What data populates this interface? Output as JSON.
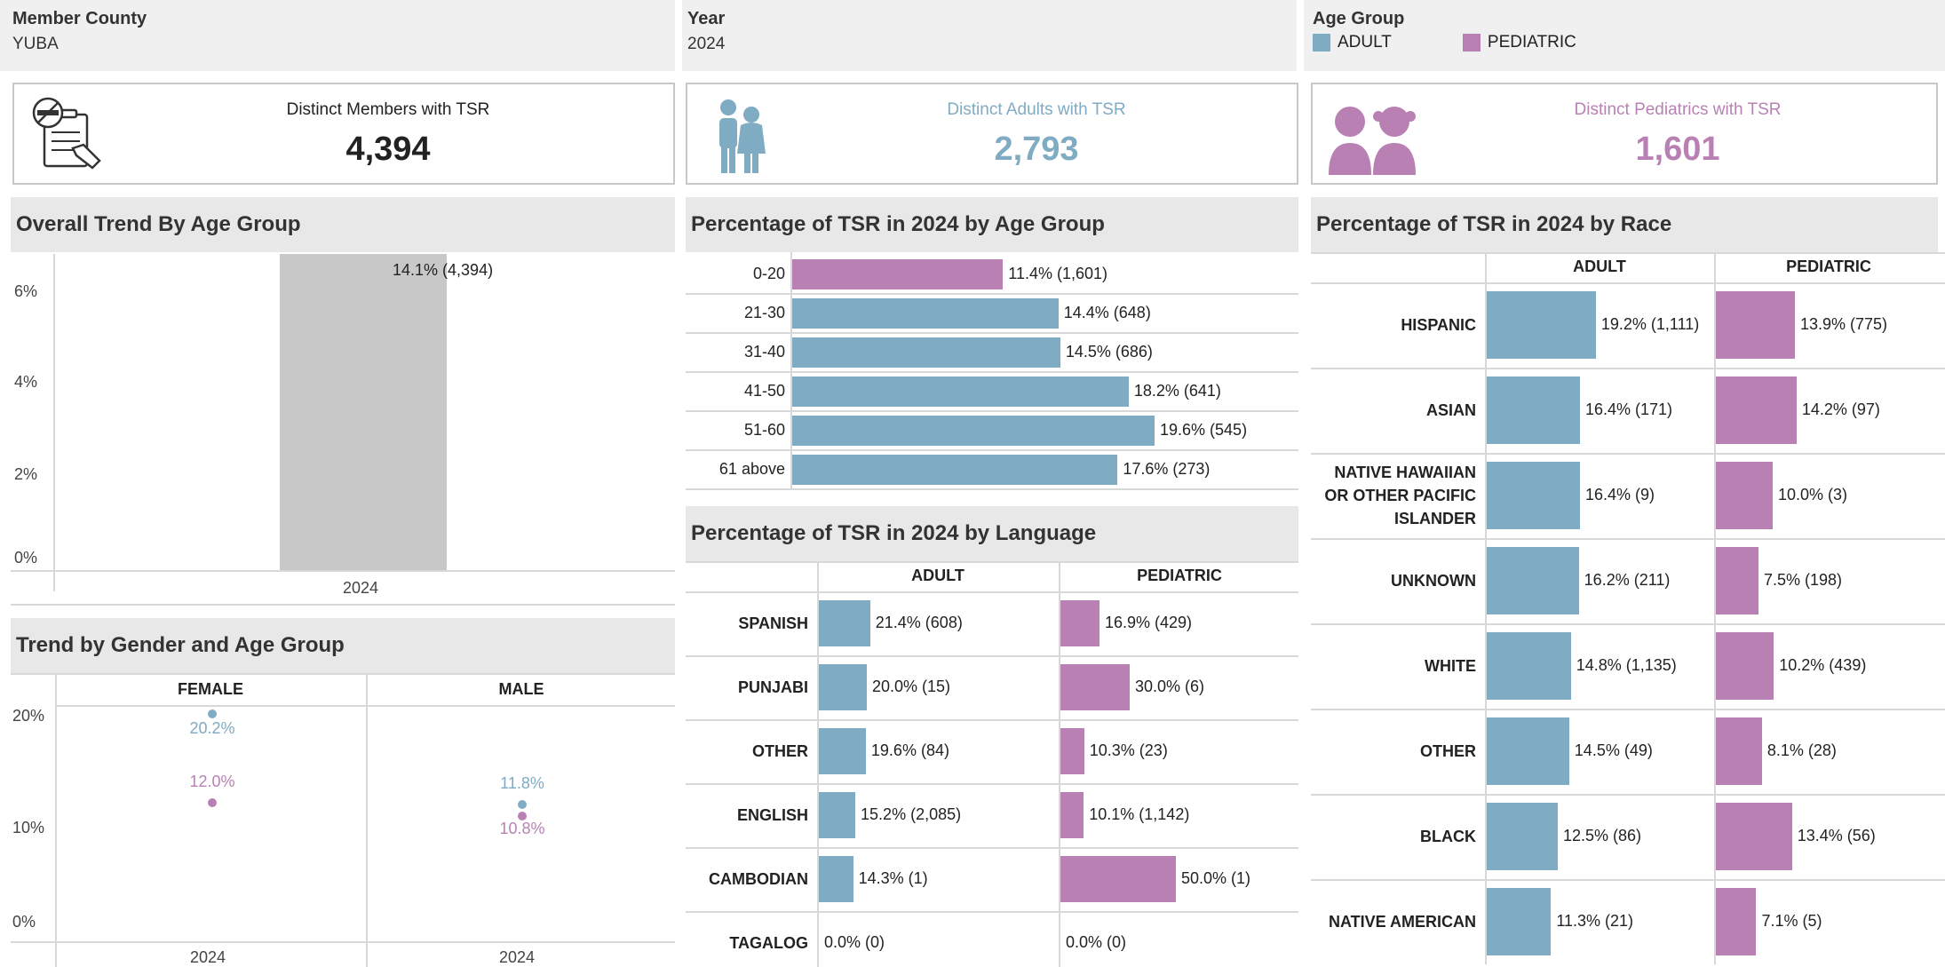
{
  "filters": {
    "member_county": {
      "label": "Member County",
      "value": "YUBA"
    },
    "year": {
      "label": "Year",
      "value": "2024"
    },
    "age_group": {
      "label": "Age Group",
      "legend": [
        {
          "label": "ADULT",
          "color": "#7fabc3"
        },
        {
          "label": "PEDIATRIC",
          "color": "#b981b3"
        }
      ]
    }
  },
  "kpis": {
    "members": {
      "title": "Distinct Members with TSR",
      "value": "4,394",
      "icon": "tsr-clipboard-icon"
    },
    "adults": {
      "title": "Distinct Adults with TSR",
      "value": "2,793",
      "icon": "adult-people-icon",
      "color": "#7fabc3"
    },
    "pediatrics": {
      "title": "Distinct Pediatrics with TSR",
      "value": "1,601",
      "icon": "child-people-icon",
      "color": "#b981b3"
    }
  },
  "overall_trend": {
    "title": "Overall Trend By Age Group",
    "y_ticks": [
      "6%",
      "4%",
      "2%",
      "0%"
    ],
    "x_label": "2024",
    "bar_label": "14.1% (4,394)"
  },
  "gender_trend": {
    "title": "Trend by Gender and Age Group",
    "columns": [
      "FEMALE",
      "MALE"
    ],
    "y_ticks": [
      "20%",
      "10%",
      "0%"
    ],
    "x_labels": [
      "2024",
      "2024"
    ],
    "female": {
      "adult": "20.2%",
      "pediatric": "12.0%"
    },
    "male": {
      "adult": "11.8%",
      "pediatric": "10.8%"
    }
  },
  "age_group_chart": {
    "title": "Percentage of TSR in 2024 by Age Group",
    "rows": [
      {
        "label": "0-20",
        "value": 11.4,
        "text": "11.4% (1,601)",
        "group": "pediatric"
      },
      {
        "label": "21-30",
        "value": 14.4,
        "text": "14.4% (648)",
        "group": "adult"
      },
      {
        "label": "31-40",
        "value": 14.5,
        "text": "14.5% (686)",
        "group": "adult"
      },
      {
        "label": "41-50",
        "value": 18.2,
        "text": "18.2% (641)",
        "group": "adult"
      },
      {
        "label": "51-60",
        "value": 19.6,
        "text": "19.6% (545)",
        "group": "adult"
      },
      {
        "label": "61 above",
        "value": 17.6,
        "text": "17.6% (273)",
        "group": "adult"
      }
    ]
  },
  "language_chart": {
    "title": "Percentage of TSR in 2024 by Language",
    "columns": [
      "ADULT",
      "PEDIATRIC"
    ],
    "rows": [
      {
        "label": "SPANISH",
        "adult": 21.4,
        "adult_text": "21.4% (608)",
        "ped": 16.9,
        "ped_text": "16.9% (429)"
      },
      {
        "label": "PUNJABI",
        "adult": 20.0,
        "adult_text": "20.0% (15)",
        "ped": 30.0,
        "ped_text": "30.0% (6)"
      },
      {
        "label": "OTHER",
        "adult": 19.6,
        "adult_text": "19.6% (84)",
        "ped": 10.3,
        "ped_text": "10.3% (23)"
      },
      {
        "label": "ENGLISH",
        "adult": 15.2,
        "adult_text": "15.2% (2,085)",
        "ped": 10.1,
        "ped_text": "10.1% (1,142)"
      },
      {
        "label": "CAMBODIAN",
        "adult": 14.3,
        "adult_text": "14.3% (1)",
        "ped": 50.0,
        "ped_text": "50.0% (1)"
      },
      {
        "label": "TAGALOG",
        "adult": 0.0,
        "adult_text": "0.0% (0)",
        "ped": 0.0,
        "ped_text": "0.0% (0)"
      }
    ]
  },
  "race_chart": {
    "title": "Percentage of TSR in 2024 by Race",
    "columns": [
      "ADULT",
      "PEDIATRIC"
    ],
    "rows": [
      {
        "label": "HISPANIC",
        "adult": 19.2,
        "adult_text": "19.2% (1,111)",
        "ped": 13.9,
        "ped_text": "13.9% (775)"
      },
      {
        "label": "ASIAN",
        "adult": 16.4,
        "adult_text": "16.4% (171)",
        "ped": 14.2,
        "ped_text": "14.2% (97)"
      },
      {
        "label": "NATIVE HAWAIIAN\nOR OTHER PACIFIC\nISLANDER",
        "adult": 16.4,
        "adult_text": "16.4% (9)",
        "ped": 10.0,
        "ped_text": "10.0% (3)"
      },
      {
        "label": "UNKNOWN",
        "adult": 16.2,
        "adult_text": "16.2% (211)",
        "ped": 7.5,
        "ped_text": "7.5% (198)"
      },
      {
        "label": "WHITE",
        "adult": 14.8,
        "adult_text": "14.8% (1,135)",
        "ped": 10.2,
        "ped_text": "10.2% (439)"
      },
      {
        "label": "OTHER",
        "adult": 14.5,
        "adult_text": "14.5% (49)",
        "ped": 8.1,
        "ped_text": "8.1% (28)"
      },
      {
        "label": "BLACK",
        "adult": 12.5,
        "adult_text": "12.5% (86)",
        "ped": 13.4,
        "ped_text": "13.4% (56)"
      },
      {
        "label": "NATIVE AMERICAN",
        "adult": 11.3,
        "adult_text": "11.3% (21)",
        "ped": 7.1,
        "ped_text": "7.1% (5)"
      }
    ]
  },
  "chart_data": [
    {
      "type": "bar",
      "title": "Overall Trend By Age Group",
      "categories": [
        "2024"
      ],
      "values": [
        14.1
      ],
      "ylim": [
        0,
        7
      ]
    },
    {
      "type": "scatter",
      "title": "Trend by Gender and Age Group",
      "categories": [
        "FEMALE",
        "MALE"
      ],
      "series": [
        {
          "name": "ADULT",
          "values": [
            20.2,
            11.8
          ]
        },
        {
          "name": "PEDIATRIC",
          "values": [
            12.0,
            10.8
          ]
        }
      ],
      "ylim": [
        0,
        20
      ]
    },
    {
      "type": "bar",
      "title": "Percentage of TSR in 2024 by Age Group",
      "categories": [
        "0-20",
        "21-30",
        "31-40",
        "41-50",
        "51-60",
        "61 above"
      ],
      "values": [
        11.4,
        14.4,
        14.5,
        18.2,
        19.6,
        17.6
      ]
    },
    {
      "type": "bar",
      "title": "Percentage of TSR in 2024 by Language",
      "categories": [
        "SPANISH",
        "PUNJABI",
        "OTHER",
        "ENGLISH",
        "CAMBODIAN",
        "TAGALOG"
      ],
      "series": [
        {
          "name": "ADULT",
          "values": [
            21.4,
            20.0,
            19.6,
            15.2,
            14.3,
            0.0
          ]
        },
        {
          "name": "PEDIATRIC",
          "values": [
            16.9,
            30.0,
            10.3,
            10.1,
            50.0,
            0.0
          ]
        }
      ]
    },
    {
      "type": "bar",
      "title": "Percentage of TSR in 2024 by Race",
      "categories": [
        "HISPANIC",
        "ASIAN",
        "NATIVE HAWAIIAN OR OTHER PACIFIC ISLANDER",
        "UNKNOWN",
        "WHITE",
        "OTHER",
        "BLACK",
        "NATIVE AMERICAN"
      ],
      "series": [
        {
          "name": "ADULT",
          "values": [
            19.2,
            16.4,
            16.4,
            16.2,
            14.8,
            14.5,
            12.5,
            11.3
          ]
        },
        {
          "name": "PEDIATRIC",
          "values": [
            13.9,
            14.2,
            10.0,
            7.5,
            10.2,
            8.1,
            13.4,
            7.1
          ]
        }
      ]
    }
  ]
}
